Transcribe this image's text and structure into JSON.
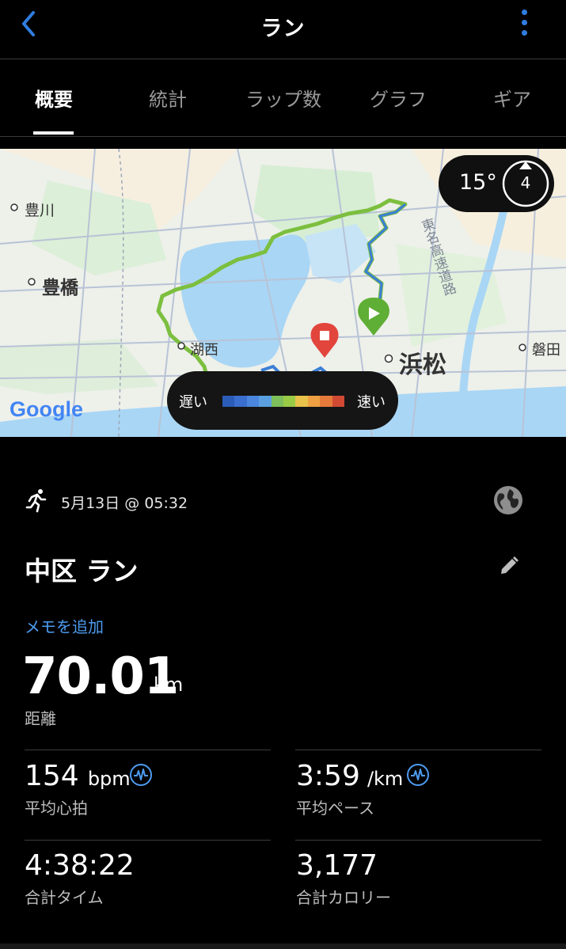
{
  "header": {
    "title": "ラン",
    "back_icon": "chevron-left-icon",
    "menu_icon": "more-vertical-icon"
  },
  "tabs": [
    {
      "label": "概要",
      "active": true
    },
    {
      "label": "統計",
      "active": false
    },
    {
      "label": "ラップ数",
      "active": false
    },
    {
      "label": "グラフ",
      "active": false
    },
    {
      "label": "ギア",
      "active": false
    }
  ],
  "map": {
    "places": {
      "toyokawa": "豊川",
      "toyohashi": "豊橋",
      "kosai": "湖西",
      "hamamatsu": "浜松",
      "iwata": "磐田",
      "expressway": "東名高速道路"
    },
    "google_logo": "Google",
    "weather": {
      "temperature": "15°",
      "wind": "4"
    },
    "pace_legend": {
      "slow": "遅い",
      "fast": "速い",
      "colors": [
        "#2b5cb8",
        "#3a6fd0",
        "#4a86de",
        "#5aa0e0",
        "#7dbf5a",
        "#9acb46",
        "#e8c24a",
        "#eea043",
        "#e67a3a",
        "#d04a33"
      ]
    }
  },
  "activity": {
    "type_icon": "running-icon",
    "date": "5月13日 @ 05:32",
    "visibility_icon": "globe-icon",
    "title": "中区 ラン",
    "edit_icon": "pencil-icon",
    "add_memo": "メモを追加",
    "distance": {
      "value": "70.01",
      "unit": "km",
      "label": "距離"
    },
    "stats": {
      "heart_rate": {
        "value": "154",
        "unit": "bpm",
        "label": "平均心拍"
      },
      "pace": {
        "value": "3:59",
        "unit": "/km",
        "label": "平均ペース"
      },
      "time": {
        "value": "4:38:22",
        "label": "合計タイム"
      },
      "calories": {
        "value": "3,177",
        "label": "合計カロリー"
      }
    }
  },
  "colors": {
    "accent_blue": "#2f7de1",
    "link_blue": "#4d9bf0",
    "route_green": "#7cbf3f",
    "route_blue": "#3b7fd6",
    "start_green": "#5fae35",
    "end_red": "#e2453c"
  }
}
